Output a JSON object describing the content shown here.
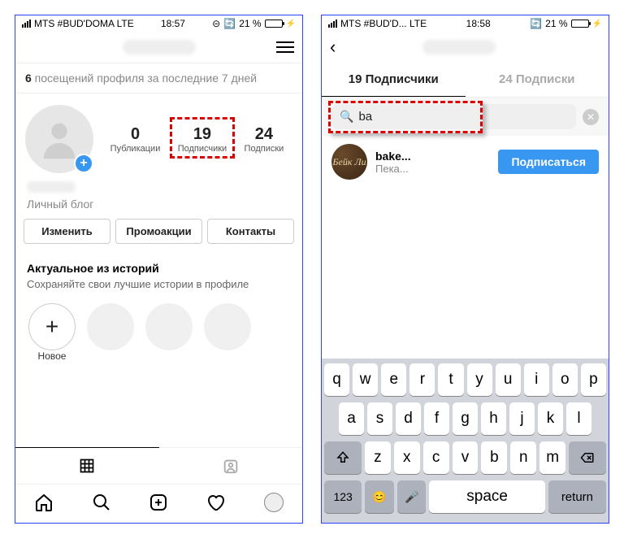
{
  "screen1": {
    "statusbar": {
      "carrier": "MTS #BUD'DOMA  LTE",
      "time": "18:57",
      "battery": "21 %"
    },
    "visits": {
      "count": "6",
      "text": " посещений профиля за последние 7 дней"
    },
    "stats": {
      "posts": {
        "num": "0",
        "label": "Публикации"
      },
      "followers": {
        "num": "19",
        "label": "Подписчики"
      },
      "following": {
        "num": "24",
        "label": "Подписки"
      }
    },
    "bio_category": "Личный блог",
    "buttons": {
      "edit": "Изменить",
      "promo": "Промоакции",
      "contacts": "Контакты"
    },
    "highlights": {
      "title": "Актуальное из историй",
      "subtitle": "Сохраняйте свои лучшие истории в профиле",
      "new": "Новое"
    }
  },
  "screen2": {
    "statusbar": {
      "carrier": "MTS #BUD'D...   LTE",
      "time": "18:58",
      "battery": "21 %"
    },
    "tabs": {
      "followers": "19 Подписчики",
      "following": "24 Подписки"
    },
    "search": {
      "query": "ba"
    },
    "result": {
      "username": "bake...",
      "subtitle": "Пека...",
      "follow": "Подписаться"
    },
    "keyboard": {
      "row1": [
        "q",
        "w",
        "e",
        "r",
        "t",
        "y",
        "u",
        "i",
        "o",
        "p"
      ],
      "row2": [
        "a",
        "s",
        "d",
        "f",
        "g",
        "h",
        "j",
        "k",
        "l"
      ],
      "row3": [
        "z",
        "x",
        "c",
        "v",
        "b",
        "n",
        "m"
      ],
      "fn123": "123",
      "space": "space",
      "return": "return"
    }
  }
}
